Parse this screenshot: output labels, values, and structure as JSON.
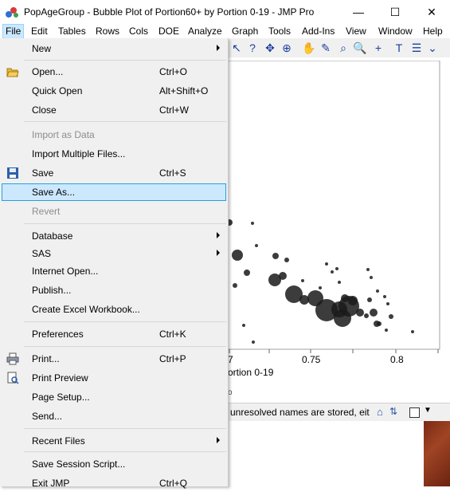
{
  "window": {
    "title": "PopAgeGroup - Bubble Plot of Portion60+ by Portion 0-19 - JMP Pro",
    "minimize_glyph": "—",
    "maximize_glyph": "☐",
    "close_glyph": "✕"
  },
  "menubar": {
    "items": [
      "File",
      "Edit",
      "Tables",
      "Rows",
      "Cols",
      "DOE",
      "Analyze",
      "Graph",
      "Tools",
      "Add-Ins",
      "View",
      "Window",
      "Help"
    ]
  },
  "file_menu": {
    "new": "New",
    "open": "Open...",
    "open_sc": "Ctrl+O",
    "quick_open": "Quick Open",
    "quick_open_sc": "Alt+Shift+O",
    "close": "Close",
    "close_sc": "Ctrl+W",
    "import_as_data": "Import as Data",
    "import_multiple": "Import Multiple Files...",
    "save": "Save",
    "save_sc": "Ctrl+S",
    "save_as": "Save As...",
    "revert": "Revert",
    "database": "Database",
    "sas": "SAS",
    "internet_open": "Internet Open...",
    "publish": "Publish...",
    "create_excel": "Create Excel Workbook...",
    "preferences": "Preferences",
    "preferences_sc": "Ctrl+K",
    "print": "Print...",
    "print_sc": "Ctrl+P",
    "print_preview": "Print Preview",
    "page_setup": "Page Setup...",
    "send": "Send...",
    "recent_files": "Recent Files",
    "save_session": "Save Session Script...",
    "exit": "Exit JMP",
    "exit_sc": "Ctrl+Q"
  },
  "plot": {
    "tick_labels": [
      "7",
      "0.75",
      "0.8"
    ],
    "x_axis_label": "ortion 0-19",
    "small_label": "o"
  },
  "status": {
    "text": "unresolved names are stored, eit"
  },
  "colors": {
    "highlight_bg": "#cce8ff",
    "highlight_border": "#26a0da",
    "menu_bg": "#f0f0f0",
    "bubble": "#1a1a1a"
  }
}
